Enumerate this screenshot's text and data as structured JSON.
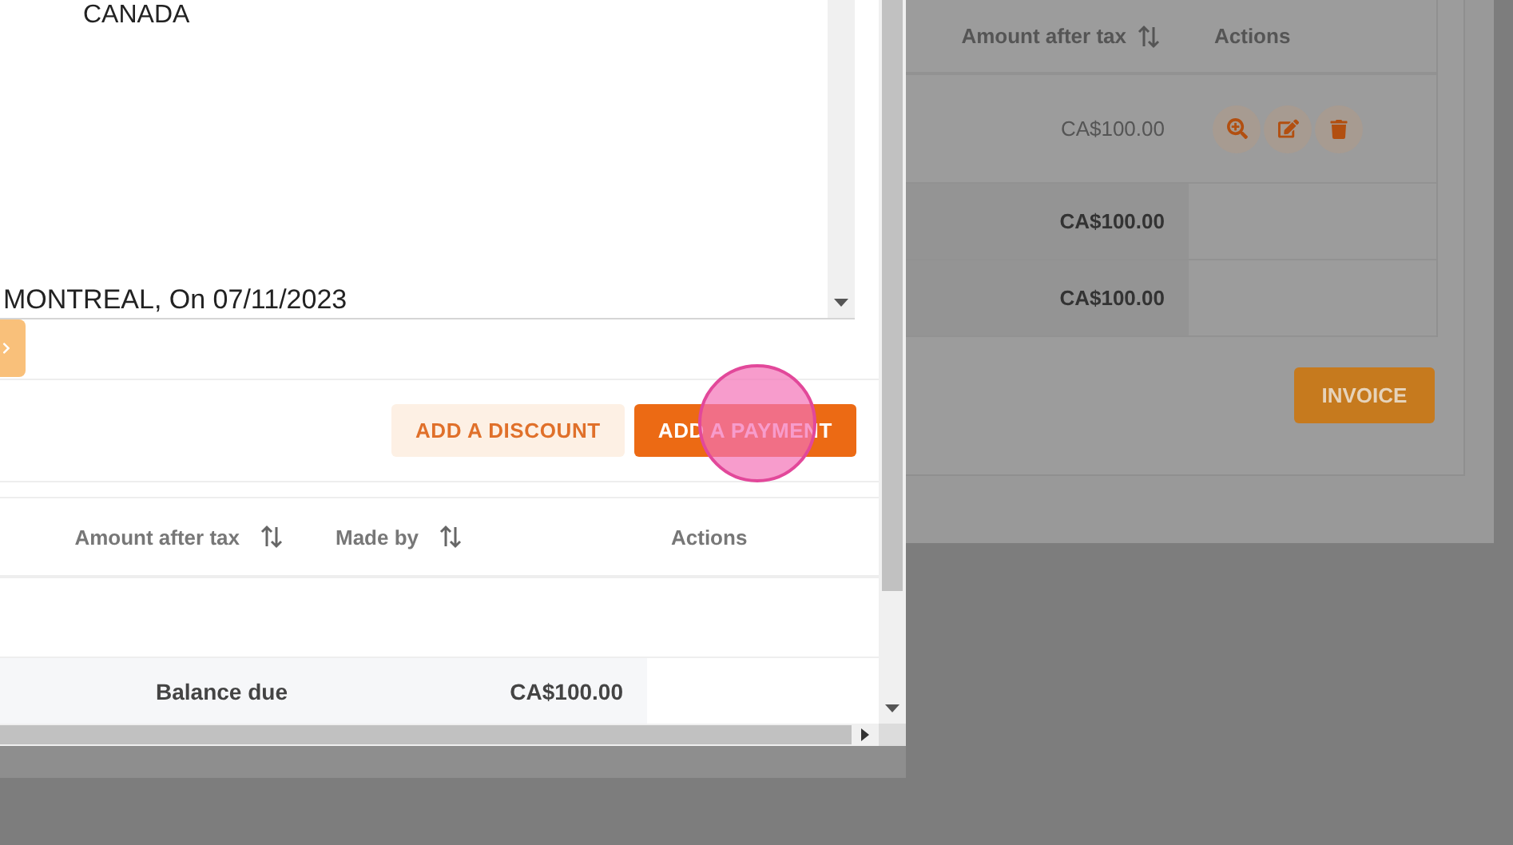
{
  "dialog": {
    "address_box": {
      "lines": [
        "CANADA"
      ],
      "signature": "MONTREAL, On 07/11/2023"
    },
    "buttons": [
      {
        "label": "ADD A DISCOUNT",
        "kind": "secondary"
      },
      {
        "label": "ADD A PAYMENT",
        "kind": "primary"
      }
    ],
    "payments_table": {
      "columns": [
        {
          "label": "Amount after tax",
          "sortable": true
        },
        {
          "label": "Made by",
          "sortable": true
        },
        {
          "label": "Actions",
          "sortable": false
        }
      ],
      "footer": {
        "label": "Balance due",
        "value": "CA$100.00"
      }
    }
  },
  "background_page": {
    "table": {
      "columns": [
        {
          "label": "Amount after tax",
          "sortable": true
        },
        {
          "label": "Actions",
          "sortable": false
        }
      ],
      "rows": [
        {
          "amount": "CA$100.00"
        }
      ],
      "totals": [
        "CA$100.00",
        "CA$100.00"
      ]
    },
    "invoice_button": "INVOICE"
  }
}
